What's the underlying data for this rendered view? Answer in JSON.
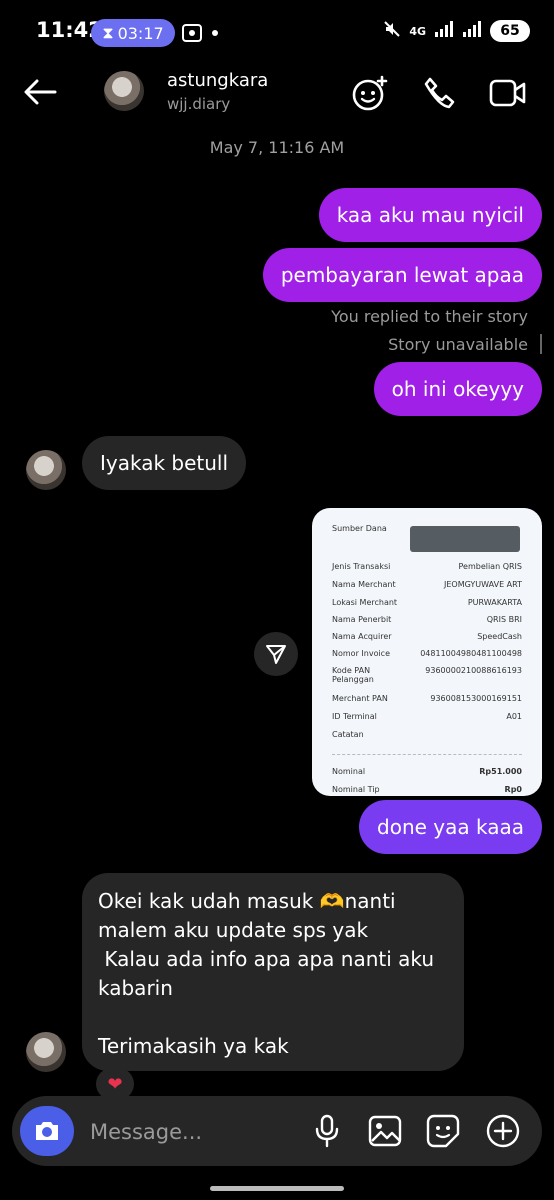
{
  "status_bar": {
    "time": "11:42",
    "timer": "03:17",
    "network": "4G",
    "battery": "65"
  },
  "header": {
    "username": "astungkara",
    "subtitle": "wjj.diary"
  },
  "conversation": {
    "timestamp": "May 7, 11:16 AM",
    "outgoing_1": "kaa aku mau nyicil",
    "outgoing_2": "pembayaran lewat apaa",
    "reply_note": "You replied to their story",
    "story_note": "Story unavailable",
    "outgoing_3": "oh ini okeyyy",
    "incoming_1": "Iyakak betull",
    "outgoing_4": "done yaa kaaa",
    "incoming_2": "Okei kak udah masuk 🫶nanti malem aku update sps yak\n Kalau ada info apa apa nanti aku kabarin\n\nTerimakasih ya kak",
    "reaction": "❤"
  },
  "receipt": {
    "rows": [
      {
        "label": "Sumber Dana",
        "value": ""
      },
      {
        "label": "Jenis Transaksi",
        "value": "Pembelian QRIS"
      },
      {
        "label": "Nama Merchant",
        "value": "JEOMGYUWAVE ART"
      },
      {
        "label": "Lokasi Merchant",
        "value": "PURWAKARTA"
      },
      {
        "label": "Nama Penerbit",
        "value": "QRIS BRI"
      },
      {
        "label": "Nama Acquirer",
        "value": "SpeedCash"
      },
      {
        "label": "Nomor Invoice",
        "value": "04811004980481100498"
      },
      {
        "label": "Kode PAN Pelanggan",
        "value": "9360000210088616193"
      },
      {
        "label": "Merchant PAN",
        "value": "936008153000169151"
      },
      {
        "label": "ID Terminal",
        "value": "A01"
      },
      {
        "label": "Catatan",
        "value": ""
      },
      {
        "label": "Nominal",
        "value": "Rp51.000"
      },
      {
        "label": "Nominal Tip",
        "value": "Rp0"
      }
    ]
  },
  "composer": {
    "placeholder": "Message..."
  },
  "icons": [
    "back-arrow-icon",
    "effects-icon",
    "phone-icon",
    "video-icon",
    "share-icon",
    "camera-icon",
    "microphone-icon",
    "gallery-icon",
    "sticker-icon",
    "plus-icon"
  ]
}
